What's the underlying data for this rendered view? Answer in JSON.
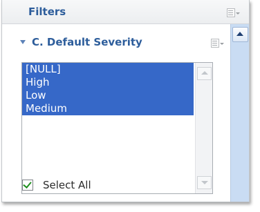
{
  "header": {
    "title": "Filters",
    "menu_icon": "panel-menu-icon"
  },
  "section": {
    "title": "C. Default Severity",
    "collapse_icon": "collapse-triangle-icon",
    "menu_icon": "section-menu-icon"
  },
  "listbox": {
    "options": [
      {
        "label": "[NULL]",
        "selected": true
      },
      {
        "label": "High",
        "selected": true
      },
      {
        "label": "Low",
        "selected": true
      },
      {
        "label": "Medium",
        "selected": true
      }
    ]
  },
  "select_all": {
    "label": "Select All",
    "checked": true
  },
  "colors": {
    "title": "#2d5d9b",
    "selection": "#3668c8",
    "scrollbar_track": "#c9dcf3"
  }
}
